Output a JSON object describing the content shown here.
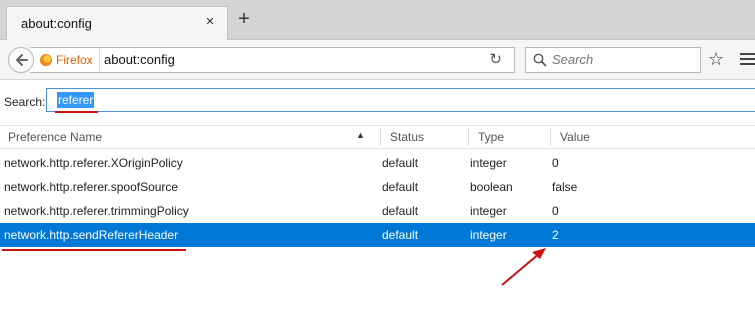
{
  "tab": {
    "title": "about:config",
    "close": "×",
    "new_tab": "+"
  },
  "navbar": {
    "identity_label": "Firefox",
    "url": "about:config",
    "reload": "↻",
    "search_placeholder": "Search",
    "bookmark": "☆"
  },
  "filter": {
    "label": "Search:",
    "value": "referer"
  },
  "columns": {
    "name": "Preference Name",
    "status": "Status",
    "type": "Type",
    "value": "Value",
    "sort_indicator": "▲"
  },
  "rows": [
    {
      "name": "network.http.referer.XOriginPolicy",
      "status": "default",
      "type": "integer",
      "value": "0"
    },
    {
      "name": "network.http.referer.spoofSource",
      "status": "default",
      "type": "boolean",
      "value": "false"
    },
    {
      "name": "network.http.referer.trimmingPolicy",
      "status": "default",
      "type": "integer",
      "value": "0"
    },
    {
      "name": "network.http.sendRefererHeader",
      "status": "default",
      "type": "integer",
      "value": "2"
    }
  ],
  "colors": {
    "selection": "#0078d7",
    "annotation": "#cc1111",
    "firefox_label": "#e66000"
  }
}
